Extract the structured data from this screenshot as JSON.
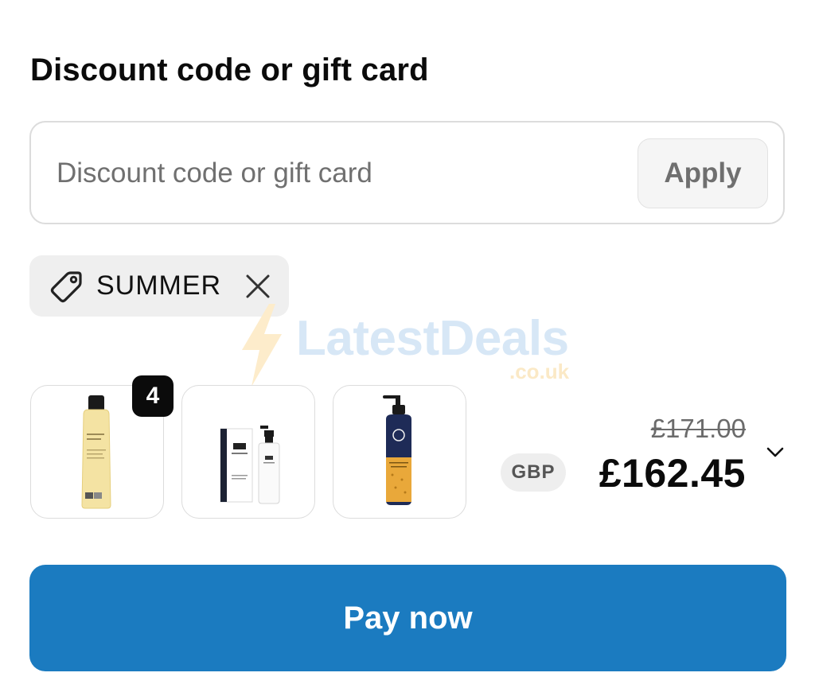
{
  "discount": {
    "title": "Discount code or gift card",
    "input_placeholder": "Discount code or gift card",
    "input_value": "",
    "apply_label": "Apply",
    "applied_code": "SUMMER"
  },
  "watermark": {
    "name": "LatestDeals",
    "domain": ".co.uk"
  },
  "order": {
    "items": [
      {
        "product": "shower-oil-bottle",
        "quantity_badge": "4"
      },
      {
        "product": "balmain-bottle-with-box"
      },
      {
        "product": "neals-yard-pump-bottle"
      }
    ],
    "original_price": "£171.00",
    "currency": "GBP",
    "total_price": "£162.45"
  },
  "pay": {
    "label": "Pay now"
  },
  "colors": {
    "pay_button": "#1b7bc0",
    "chip_background": "#efefef",
    "border": "#dcdcdc"
  },
  "icons": {
    "tag": "tag-icon",
    "remove": "close-icon",
    "expand": "chevron-down-icon"
  }
}
